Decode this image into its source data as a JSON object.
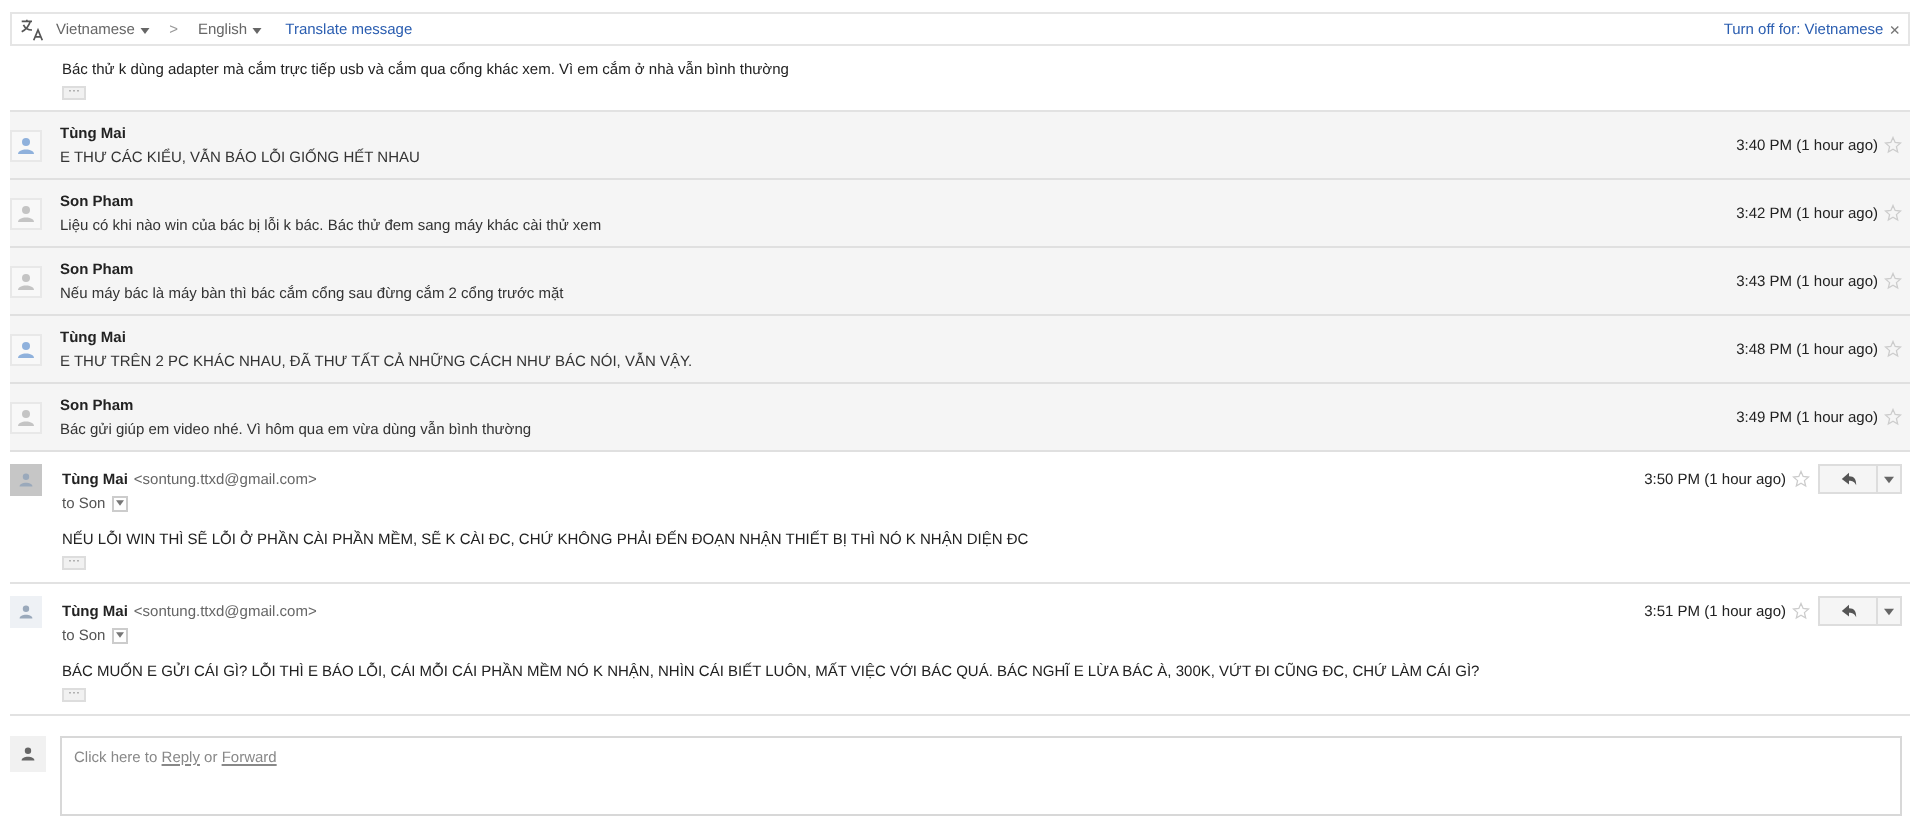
{
  "translate_bar": {
    "source_language": "Vietnamese",
    "arrow": ">",
    "target_language": "English",
    "translate_link": "Translate message",
    "turn_off": "Turn off for: Vietnamese",
    "close": "×"
  },
  "open_message": {
    "body": "Bác thử k dùng adapter mà cắm trực tiếp usb và cắm qua cổng khác xem. Vì em cắm ở nhà vẫn bình thường",
    "more": "···"
  },
  "collapsed_messages": [
    {
      "sender": "Tùng Mai",
      "snippet": "E THƯ CÁC KIỂU, VẪN BÁO LỖI GIỐNG HẾT NHAU",
      "time": "3:40 PM (1 hour ago)",
      "starred": false,
      "color": "#8fb1dc"
    },
    {
      "sender": "Son Pham",
      "snippet": "Liệu có khi nào win của bác bị lỗi k bác. Bác thử đem sang máy khác cài thử xem",
      "time": "3:42 PM (1 hour ago)",
      "starred": false,
      "color": "#c4c4c4"
    },
    {
      "sender": "Son Pham",
      "snippet": "Nếu máy bác là máy bàn thì bác cắm cổng sau đừng cắm 2 cổng trước mặt",
      "time": "3:43 PM (1 hour ago)",
      "starred": false,
      "color": "#c4c4c4"
    },
    {
      "sender": "Tùng Mai",
      "snippet": "E THƯ TRÊN 2 PC KHÁC NHAU, ĐÃ THƯ TẤT CẢ NHỮNG CÁCH NHƯ BÁC NÓI, VẪN VẬY.",
      "time": "3:48 PM (1 hour ago)",
      "starred": false,
      "color": "#8fb1dc"
    },
    {
      "sender": "Son Pham",
      "snippet": "Bác gửi giúp em video nhé. Vì hôm qua em vừa dùng vẫn bình thường",
      "time": "3:49 PM (1 hour ago)",
      "starred": false,
      "color": "#c4c4c4"
    }
  ],
  "expanded_messages": [
    {
      "sender": "Tùng Mai",
      "email": "<sontung.ttxd@gmail.com>",
      "to": "to Son",
      "time": "3:50 PM (1 hour ago)",
      "starred": false,
      "body": "NẾU LỖI WIN THÌ SẼ LỖI Ở PHẦN CÀI PHẦN MỀM, SẼ K CÀI ĐC, CHỨ KHÔNG PHẢI ĐẾN ĐOẠN NHẬN THIẾT BỊ THÌ NÓ K NHẬN DIỆN ĐC",
      "more": "···"
    },
    {
      "sender": "Tùng Mai",
      "email": "<sontung.ttxd@gmail.com>",
      "to": "to Son",
      "time": "3:51 PM (1 hour ago)",
      "starred": false,
      "body": "BÁC MUỐN E GỬI CÁI GÌ? LỖI THÌ E BÁO LỖI, CÁI MỖI CÁI PHẦN MỀM NÓ K NHẬN, NHÌN CÁI BIẾT LUÔN, MẤT VIỆC VỚI BÁC QUÁ. BÁC NGHĨ E LỪA BÁC À, 300K, VỨT ĐI CŨNG ĐC, CHỨ LÀM CÁI GÌ?",
      "more": "···"
    }
  ],
  "reply_box": {
    "prefix": "Click here to",
    "reply_link": "Reply",
    "middle": "or",
    "forward_link": "Forward"
  }
}
